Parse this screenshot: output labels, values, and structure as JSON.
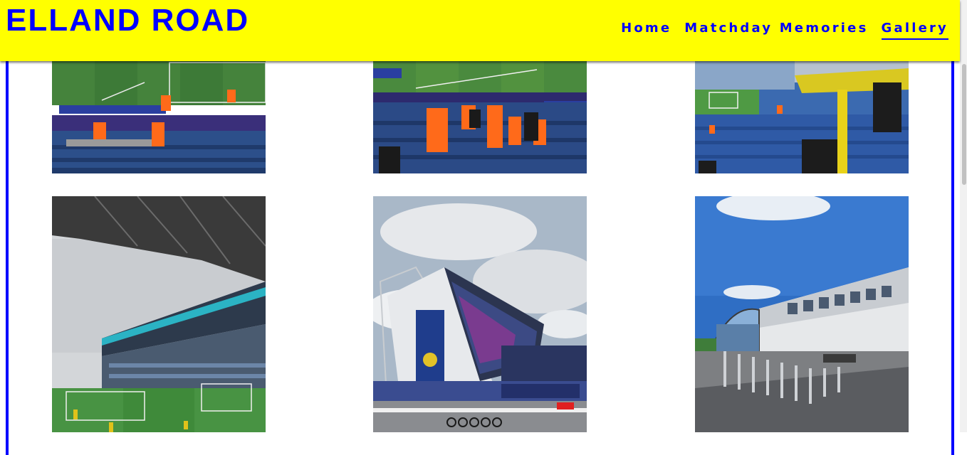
{
  "header": {
    "title": "ELLAND ROAD",
    "nav": [
      {
        "label": "Home"
      },
      {
        "label": "Matchday Memories"
      },
      {
        "label": "Gallery",
        "active": true
      }
    ]
  },
  "colors": {
    "header_bg": "#ffff00",
    "brand_blue": "#0000ff"
  },
  "gallery": {
    "photos": [
      {
        "subject": "stewards-in-front-of-stand-pitch-view"
      },
      {
        "subject": "stewards-in-seating-area-pitch-view"
      },
      {
        "subject": "fans-in-stand-side-view"
      },
      {
        "subject": "east-stand-roof-view-from-seats"
      },
      {
        "subject": "stadium-exterior-hisense-stand"
      },
      {
        "subject": "centenary-square-exterior"
      }
    ]
  }
}
